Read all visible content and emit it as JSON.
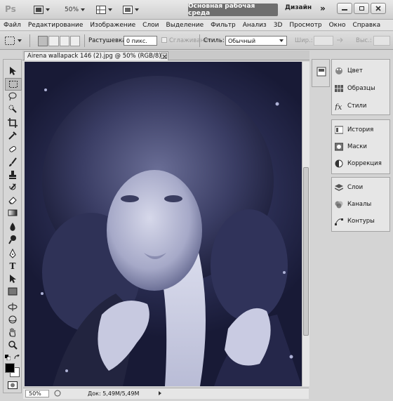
{
  "app": {
    "logo": "Ps",
    "zoom": "50%",
    "workspace_primary": "Основная рабочая среда",
    "workspace_secondary": "Дизайн",
    "more_symbol": "»"
  },
  "menu": [
    "Файл",
    "Редактирование",
    "Изображение",
    "Слои",
    "Выделение",
    "Фильтр",
    "Анализ",
    "3D",
    "Просмотр",
    "Окно",
    "Справка"
  ],
  "options": {
    "feather_label": "Растушевка:",
    "feather_value": "0 пикс.",
    "antialias_label": "Сглаживание",
    "style_label": "Стиль:",
    "style_value": "Обычный",
    "width_label": "Шир.:",
    "height_label": "Выс.:"
  },
  "document": {
    "tab_title": "Airena wallapack 146 (2).jpg @ 50% (RGB/8)",
    "zoom": "50%",
    "doc_size": "Док: 5,49M/5,49M"
  },
  "panels": {
    "group1": [
      "Цвет",
      "Образцы",
      "Стили"
    ],
    "group2": [
      "История",
      "Маски",
      "Коррекция"
    ],
    "group3": [
      "Слои",
      "Каналы",
      "Контуры"
    ]
  },
  "colors": {
    "foreground": "#000000",
    "background": "#ffffff",
    "workspace_button": "#6e6e6e"
  },
  "icons": {
    "tools": [
      "move-icon",
      "marquee-icon",
      "lasso-icon",
      "quick-select-icon",
      "crop-icon",
      "eyedropper-icon",
      "healing-icon",
      "brush-icon",
      "stamp-icon",
      "history-brush-icon",
      "eraser-icon",
      "gradient-icon",
      "blur-icon",
      "dodge-icon",
      "pen-icon",
      "type-icon",
      "path-select-icon",
      "shape-icon",
      "3d-rotate-icon",
      "3d-orbit-icon",
      "hand-icon",
      "zoom-icon"
    ]
  }
}
